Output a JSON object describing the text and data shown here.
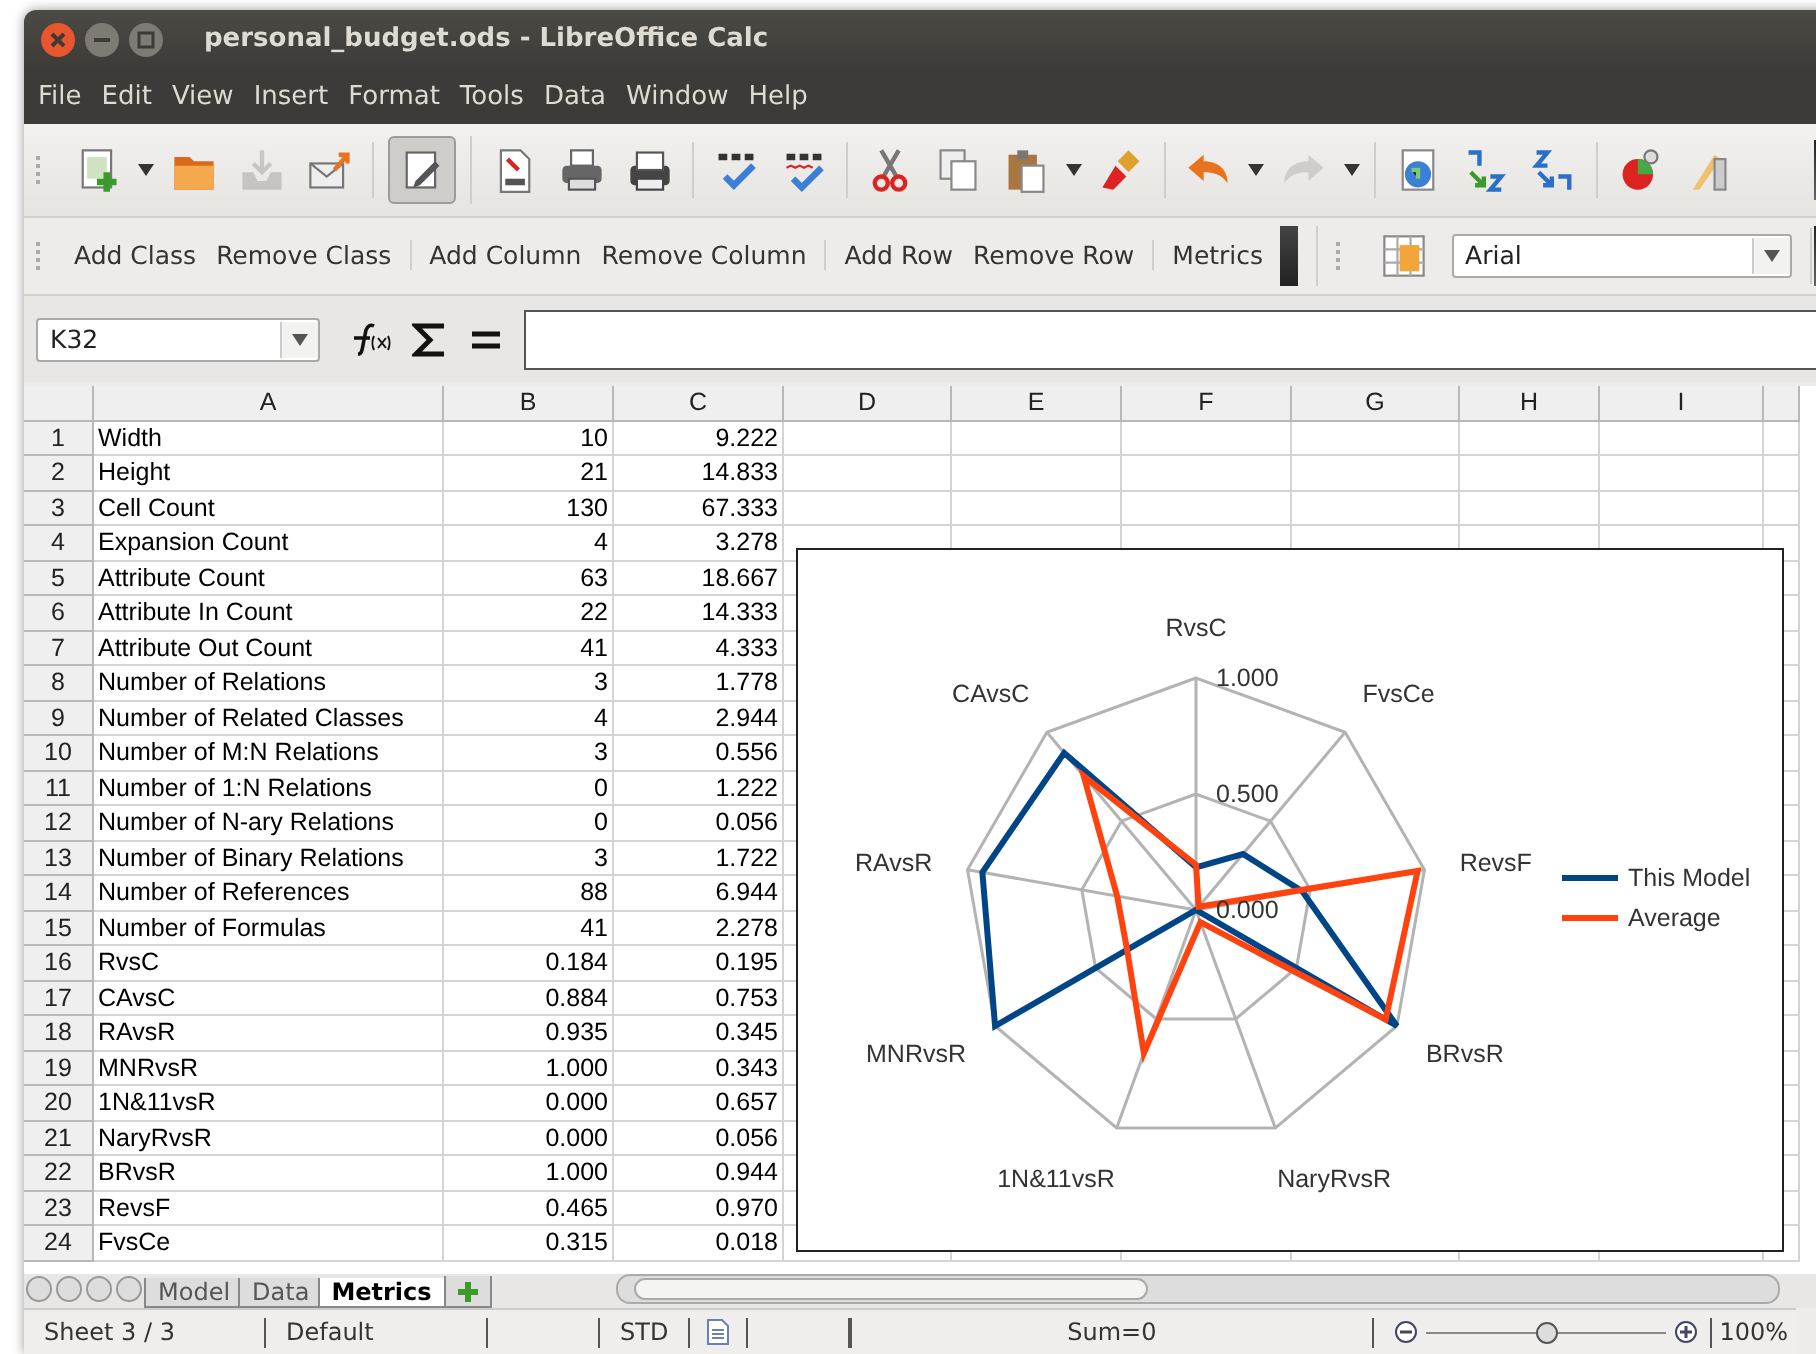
{
  "window": {
    "title": "personal_budget.ods - LibreOffice Calc"
  },
  "menu": [
    "File",
    "Edit",
    "View",
    "Insert",
    "Format",
    "Tools",
    "Data",
    "Window",
    "Help"
  ],
  "standard_toolbar": [
    [
      {
        "dropdown": true,
        "disabled": false,
        "pressed": false
      },
      {
        "dropdown": false,
        "disabled": false,
        "pressed": false
      },
      {
        "dropdown": false,
        "disabled": true,
        "pressed": false
      },
      {
        "dropdown": false,
        "disabled": false,
        "pressed": false
      }
    ],
    [
      {
        "dropdown": false,
        "disabled": false,
        "pressed": true
      }
    ],
    [
      {
        "dropdown": false,
        "disabled": false,
        "pressed": false
      },
      {
        "dropdown": false,
        "disabled": false,
        "pressed": false
      },
      {
        "dropdown": false,
        "disabled": false,
        "pressed": false
      }
    ],
    [
      {
        "dropdown": false,
        "disabled": false,
        "pressed": false
      },
      {
        "dropdown": false,
        "disabled": false,
        "pressed": false
      }
    ],
    [
      {
        "dropdown": false,
        "disabled": false,
        "pressed": false
      },
      {
        "dropdown": false,
        "disabled": false,
        "pressed": false
      },
      {
        "dropdown": true,
        "disabled": false,
        "pressed": false
      },
      {
        "dropdown": false,
        "disabled": false,
        "pressed": false
      }
    ],
    [
      {
        "dropdown": true,
        "disabled": false,
        "pressed": false
      },
      {
        "dropdown": true,
        "disabled": true,
        "pressed": false
      }
    ],
    [
      {
        "dropdown": false,
        "disabled": false,
        "pressed": false
      },
      {
        "dropdown": false,
        "disabled": false,
        "pressed": false
      },
      {
        "dropdown": false,
        "disabled": false,
        "pressed": false
      }
    ],
    [
      {
        "dropdown": false,
        "disabled": false,
        "pressed": false
      },
      {
        "dropdown": false,
        "disabled": false,
        "pressed": false
      }
    ]
  ],
  "custom_toolbar": {
    "groups": [
      [
        "Add Class",
        "Remove Class"
      ],
      [
        "Add Column",
        "Remove Column"
      ],
      [
        "Add Row",
        "Remove Row"
      ],
      [
        "Metrics"
      ]
    ],
    "font_name": "Arial"
  },
  "formula_bar": {
    "cell_reference": "K32"
  },
  "sheet": {
    "columns": [
      "A",
      "B",
      "C",
      "D",
      "E",
      "F",
      "G",
      "H",
      "I"
    ],
    "rows": [
      {
        "number": "1",
        "cells": [
          "Width",
          "10",
          "9.222"
        ]
      },
      {
        "number": "2",
        "cells": [
          "Height",
          "21",
          "14.833"
        ]
      },
      {
        "number": "3",
        "cells": [
          "Cell Count",
          "130",
          "67.333"
        ]
      },
      {
        "number": "4",
        "cells": [
          "Expansion Count",
          "4",
          "3.278"
        ]
      },
      {
        "number": "5",
        "cells": [
          "Attribute Count",
          "63",
          "18.667"
        ]
      },
      {
        "number": "6",
        "cells": [
          "Attribute In Count",
          "22",
          "14.333"
        ]
      },
      {
        "number": "7",
        "cells": [
          "Attribute Out Count",
          "41",
          "4.333"
        ]
      },
      {
        "number": "8",
        "cells": [
          "Number of Relations",
          "3",
          "1.778"
        ]
      },
      {
        "number": "9",
        "cells": [
          "Number of Related Classes",
          "4",
          "2.944"
        ]
      },
      {
        "number": "10",
        "cells": [
          "Number of M:N Relations",
          "3",
          "0.556"
        ]
      },
      {
        "number": "11",
        "cells": [
          "Number of 1:N Relations",
          "0",
          "1.222"
        ]
      },
      {
        "number": "12",
        "cells": [
          "Number of N-ary Relations",
          "0",
          "0.056"
        ]
      },
      {
        "number": "13",
        "cells": [
          "Number of Binary Relations",
          "3",
          "1.722"
        ]
      },
      {
        "number": "14",
        "cells": [
          "Number of References",
          "88",
          "6.944"
        ]
      },
      {
        "number": "15",
        "cells": [
          "Number of Formulas",
          "41",
          "2.278"
        ]
      },
      {
        "number": "16",
        "cells": [
          "RvsC",
          "0.184",
          "0.195"
        ]
      },
      {
        "number": "17",
        "cells": [
          "CAvsC",
          "0.884",
          "0.753"
        ]
      },
      {
        "number": "18",
        "cells": [
          "RAvsR",
          "0.935",
          "0.345"
        ]
      },
      {
        "number": "19",
        "cells": [
          "MNRvsR",
          "1.000",
          "0.343"
        ]
      },
      {
        "number": "20",
        "cells": [
          "1N&11vsR",
          "0.000",
          "0.657"
        ]
      },
      {
        "number": "21",
        "cells": [
          "NaryRvsR",
          "0.000",
          "0.056"
        ]
      },
      {
        "number": "22",
        "cells": [
          "BRvsR",
          "1.000",
          "0.944"
        ]
      },
      {
        "number": "23",
        "cells": [
          "RevsF",
          "0.465",
          "0.970"
        ]
      },
      {
        "number": "24",
        "cells": [
          "FvsCe",
          "0.315",
          "0.018"
        ]
      }
    ],
    "chart": {
      "axis_labels": [
        "RvsC",
        "CAvsC",
        "RAvsR",
        "MNRvsR",
        "1N&11vsR",
        "NaryRvsR",
        "BRvsR",
        "RevsF",
        "FvsCe"
      ],
      "tick_labels": [
        "1.000",
        "0.500",
        "0.000"
      ],
      "legend": [
        {
          "name": "This Model",
          "color": "#004586"
        },
        {
          "name": "Average",
          "color": "#ff420e"
        }
      ]
    }
  },
  "sheet_tabs": [
    {
      "label": "Model",
      "selected": false
    },
    {
      "label": "Data",
      "selected": false
    },
    {
      "label": "Metrics",
      "selected": true
    }
  ],
  "status_bar": {
    "sheet": "Sheet 3 / 3",
    "page_style": "Default",
    "selection_mode": "STD",
    "sum": "Sum=0",
    "zoom": "100%",
    "zoom_slider": {
      "level": 0.5
    }
  }
}
